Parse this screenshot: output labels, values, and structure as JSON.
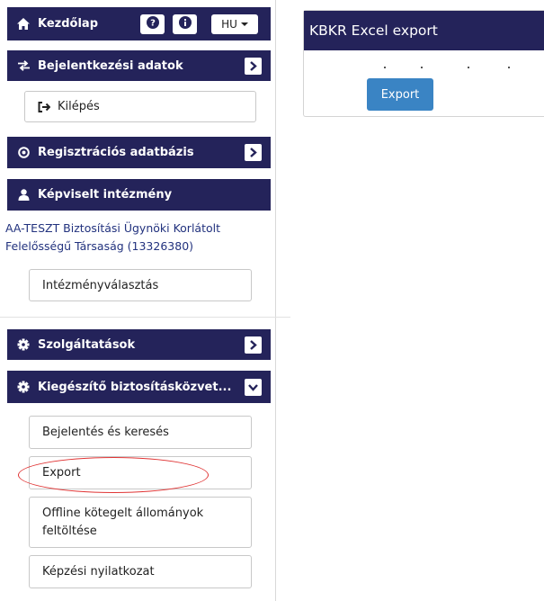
{
  "header": {
    "home_label": "Kezdőlap",
    "help_icon": "question-circle-icon",
    "info_icon": "info-circle-icon",
    "language": "HU"
  },
  "login_section": {
    "title": "Bejelentkezési adatok",
    "logout_label": "Kilépés"
  },
  "registry_section": {
    "title": "Regisztrációs adatbázis"
  },
  "institution_section": {
    "title": "Képviselt intézmény",
    "institution_name": "AA-TESZT Biztosítási Ügynöki Korlátolt Felelősségű Társaság (13326380)",
    "select_button": "Intézményválasztás"
  },
  "services_section": {
    "title": "Szolgáltatások"
  },
  "supplementary_section": {
    "title": "Kiegészítő biztosításközvet...",
    "items": [
      {
        "label": "Bejelentés és keresés"
      },
      {
        "label": "Export"
      },
      {
        "label": "Offline kötegelt állományok feltöltése"
      },
      {
        "label": "Képzési nyilatkozat"
      }
    ]
  },
  "main": {
    "panel_title": "KBKR Excel export",
    "export_button": "Export"
  },
  "colors": {
    "navbar": "#24235a",
    "button_primary": "#3a84c4",
    "link_text": "#22327e",
    "highlight": "#e03535"
  }
}
